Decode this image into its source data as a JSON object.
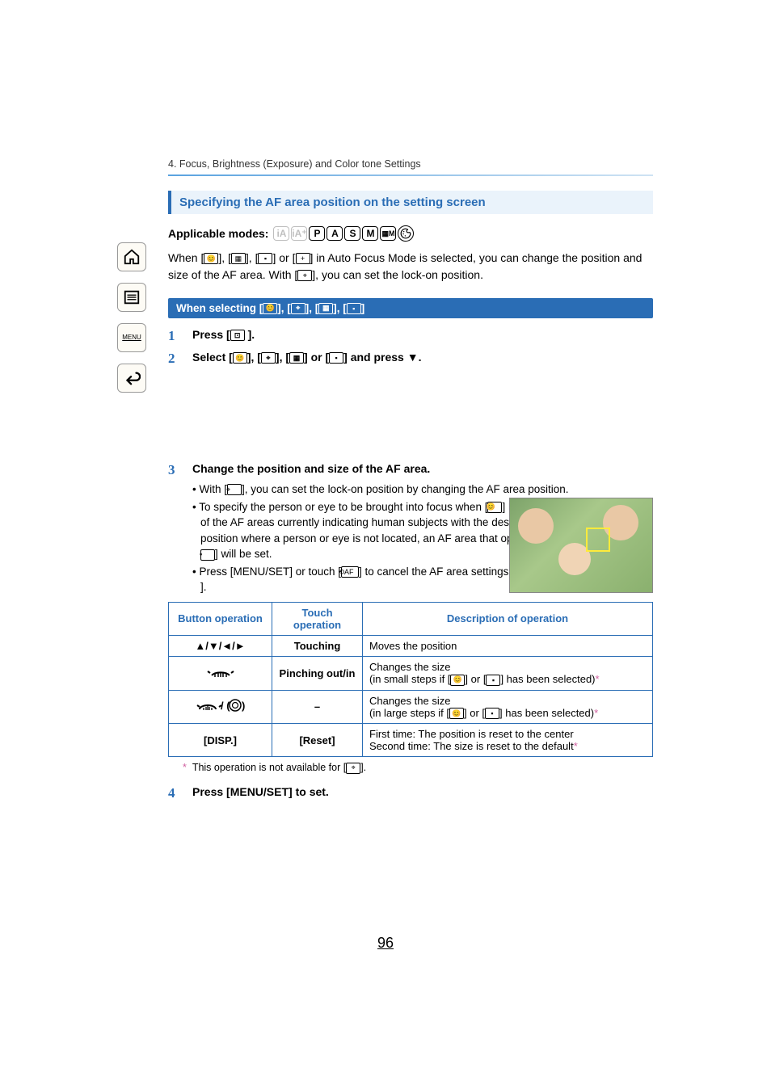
{
  "breadcrumb": "4. Focus, Brightness (Exposure) and Color tone Settings",
  "section_title": "Specifying the AF area position on the setting screen",
  "applicable_label": "Applicable modes:",
  "modes": {
    "p": "P",
    "a": "A",
    "s": "S",
    "m": "M"
  },
  "intro_a": "When [",
  "intro_b": "], [",
  "intro_c": "], [",
  "intro_d": "] or [",
  "intro_e": "] in Auto Focus Mode is selected, you can change the position and size of the AF area. With [",
  "intro_f": "], you can set the lock-on position.",
  "sub_title_a": "When selecting [",
  "sub_title_b": "], [",
  "sub_title_c": "], [",
  "sub_title_d": "], [",
  "sub_title_e": "]",
  "steps": {
    "s1": {
      "num": "1",
      "text_a": "Press [",
      "text_b": " ]."
    },
    "s2": {
      "num": "2",
      "text_a": "Select [",
      "text_b": "], [",
      "text_c": "], [",
      "text_d": "] or [",
      "text_e": "] and press ",
      "text_f": "."
    },
    "s3": {
      "num": "3",
      "text": "Change the position and size of the AF area."
    },
    "s4": {
      "num": "4",
      "text": "Press [MENU/SET] to set."
    }
  },
  "bullets": {
    "b1_a": "With [",
    "b1_b": "], you can set the lock-on position by changing the AF area position.",
    "b2_a": "To specify the person or eye to be brought into focus when [",
    "b2_b": "] has been selected, align any of the AF areas currently indicating human subjects with the desired person or eye. For any position where a person or eye is not located, an AF area that operates in the same way as [",
    "b2_c": "] will be set.",
    "b3_a": "Press [MENU/SET] or touch [",
    "b3_b": "] to cancel the AF area settings when using [",
    "b3_c": "], [",
    "b3_d": "] or [",
    "b3_e": "]."
  },
  "table": {
    "h1": "Button operation",
    "h2": "Touch operation",
    "h3": "Description of operation",
    "r1c1": "▲/▼/◄/►",
    "r1c2": "Touching",
    "r1c3": "Moves the position",
    "r2c2": "Pinching out/in",
    "r2c3a": "Changes the size",
    "r2c3b": "(in small steps if [",
    "r2c3c": "] or [",
    "r2c3d": "] has been selected)",
    "r3c2": "–",
    "r3c3a": "Changes the size",
    "r3c3b": "(in large steps if [",
    "r3c3c": "] or [",
    "r3c3d": "] has been selected)",
    "r4c1": "[DISP.]",
    "r4c2": "[Reset]",
    "r4c3a": "First time: The position is reset to the center",
    "r4c3b": "Second time: The size is reset to the default"
  },
  "footnote_a": "This operation is not available for [",
  "footnote_b": "].",
  "page": "96",
  "sidebar_menu": "MENU"
}
